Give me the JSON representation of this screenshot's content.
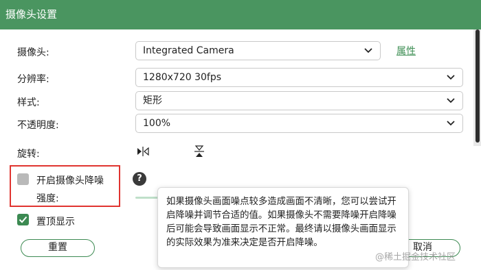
{
  "window": {
    "title": "摄像头设置"
  },
  "colors": {
    "accent": "#4a9560",
    "highlight_box": "#e0332f",
    "link": "#3f8f55"
  },
  "fields": {
    "camera": {
      "label": "摄像头:",
      "value": "Integrated Camera",
      "properties_link": "属性"
    },
    "resolution": {
      "label": "分辨率:",
      "value": "1280x720 30fps"
    },
    "style": {
      "label": "样式:",
      "value": "矩形"
    },
    "opacity": {
      "label": "不透明度:",
      "value": "100%"
    },
    "rotation": {
      "label": "旋转:",
      "icons": [
        "flip-horizontal-icon",
        "flip-vertical-icon"
      ]
    }
  },
  "denoise": {
    "label": "开启摄像头降噪",
    "checked": false,
    "strength_label": "强度:",
    "help_icon": "?"
  },
  "always_on_top": {
    "label": "置顶显示",
    "checked": true
  },
  "footer": {
    "reset_label": "重置",
    "cancel_label": "取消"
  },
  "tooltip": {
    "text": "如果摄像头画面噪点较多造成画面不清晰，您可以尝试开启降噪并调节合适的值。如果摄像头不需要降噪开启降噪后可能会导致画面显示不正常。最终请以摄像头画面显示的实际效果为准来决定是否开启降噪。"
  },
  "watermark": "@稀土掘金技术社区"
}
